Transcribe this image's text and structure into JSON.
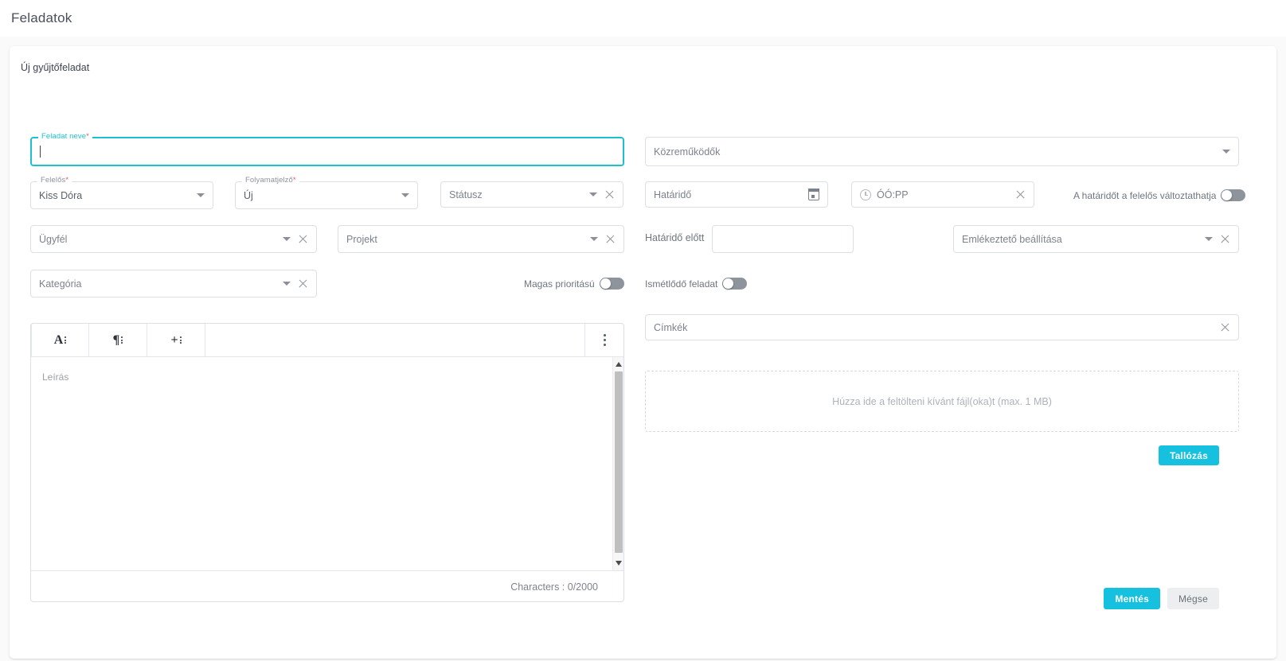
{
  "header": {
    "title": "Feladatok"
  },
  "card": {
    "title": "Új gyűjtőfeladat"
  },
  "fields": {
    "task_name": {
      "label": "Feladat neve",
      "required": "*",
      "value": "",
      "placeholder": ""
    },
    "assignee": {
      "label": "Felelős",
      "required": "*",
      "value": "Kiss Dóra"
    },
    "progress": {
      "label": "Folyamatjelző",
      "required": "*",
      "value": "Új"
    },
    "status": {
      "placeholder": "Státusz",
      "value": ""
    },
    "client": {
      "placeholder": "Ügyfél",
      "value": ""
    },
    "project": {
      "placeholder": "Projekt",
      "value": ""
    },
    "category": {
      "placeholder": "Kategória",
      "value": ""
    },
    "collaborators": {
      "placeholder": "Közreműködők",
      "value": ""
    },
    "deadline": {
      "placeholder": "Határidő",
      "value": ""
    },
    "deadline_time": {
      "placeholder": "ÓÓ:PP",
      "value": ""
    },
    "before_deadline": {
      "label": "Határidő előtt",
      "value": ""
    },
    "reminder": {
      "placeholder": "Emlékeztető beállítása",
      "value": ""
    },
    "tags": {
      "placeholder": "Címkék",
      "value": ""
    }
  },
  "toggles": {
    "deadline_editable": {
      "label": "A határidőt a felelős változtathatja",
      "state": "off"
    },
    "high_priority": {
      "label": "Magas prioritású",
      "state": "off"
    },
    "recurring": {
      "label": "Ismétlődő feladat",
      "state": "off"
    }
  },
  "editor": {
    "placeholder": "Leírás",
    "char_counter": "Characters : 0/2000",
    "toolbar": {
      "text_format_glyph": "A",
      "paragraph_glyph": "¶",
      "insert_glyph": "+"
    }
  },
  "upload": {
    "dropzone_text": "Húzza ide a feltölteni kívánt fájl(oka)t (max. 1 MB)",
    "browse_label": "Tallózás"
  },
  "footer": {
    "save_label": "Mentés",
    "cancel_label": "Mégse"
  },
  "colors": {
    "accent": "#16c1e0",
    "focus_border": "#1ec0cf",
    "required_mark": "#e05c5c"
  }
}
